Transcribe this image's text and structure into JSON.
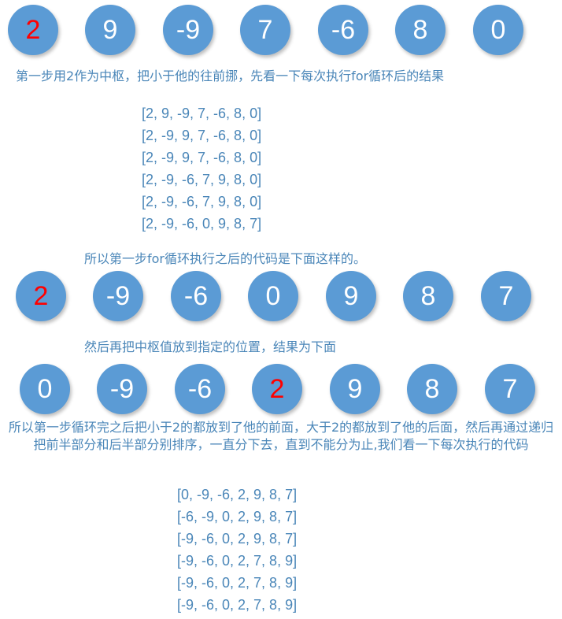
{
  "row1": [
    "2",
    "9",
    "-9",
    "7",
    "-6",
    "8",
    "0"
  ],
  "caption1": "第一步用2作为中枢，把小于他的往前挪，先看一下每次执行for循环后的结果",
  "arrays1": [
    "[2, 9, -9, 7, -6, 8, 0]",
    "[2, -9, 9, 7, -6, 8, 0]",
    "[2, -9, 9, 7, -6, 8, 0]",
    "[2, -9, -6, 7, 9, 8, 0]",
    "[2, -9, -6, 7, 9, 8, 0]",
    "[2, -9, -6, 0, 9, 8, 7]"
  ],
  "caption2": "所以第一步for循环执行之后的代码是下面这样的。",
  "row2": [
    "2",
    "-9",
    "-6",
    "0",
    "9",
    "8",
    "7"
  ],
  "caption3": "然后再把中枢值放到指定的位置，结果为下面",
  "row3": [
    "0",
    "-9",
    "-6",
    "2",
    "9",
    "8",
    "7"
  ],
  "caption4": "所以第一步循环完之后把小于2的都放到了他的前面，大于2的都放到了他的后面，然后再通过递归把前半部分和后半部分别排序，一直分下去，直到不能分为止,我们看一下每次执行的代码",
  "arrays2": [
    "[0, -9, -6, 2, 9, 8, 7]",
    "[-6, -9, 0, 2, 9, 8, 7]",
    "[-9, -6, 0, 2, 9, 8, 7]",
    "[-9, -6, 0, 2, 7, 8, 9]",
    "[-9, -6, 0, 2, 7, 8, 9]",
    "[-9, -6, 0, 2, 7, 8, 9]"
  ],
  "colors": {
    "circle": "#5b9bd5",
    "pivot_text": "#ff0000",
    "text": "#4a86b8"
  }
}
